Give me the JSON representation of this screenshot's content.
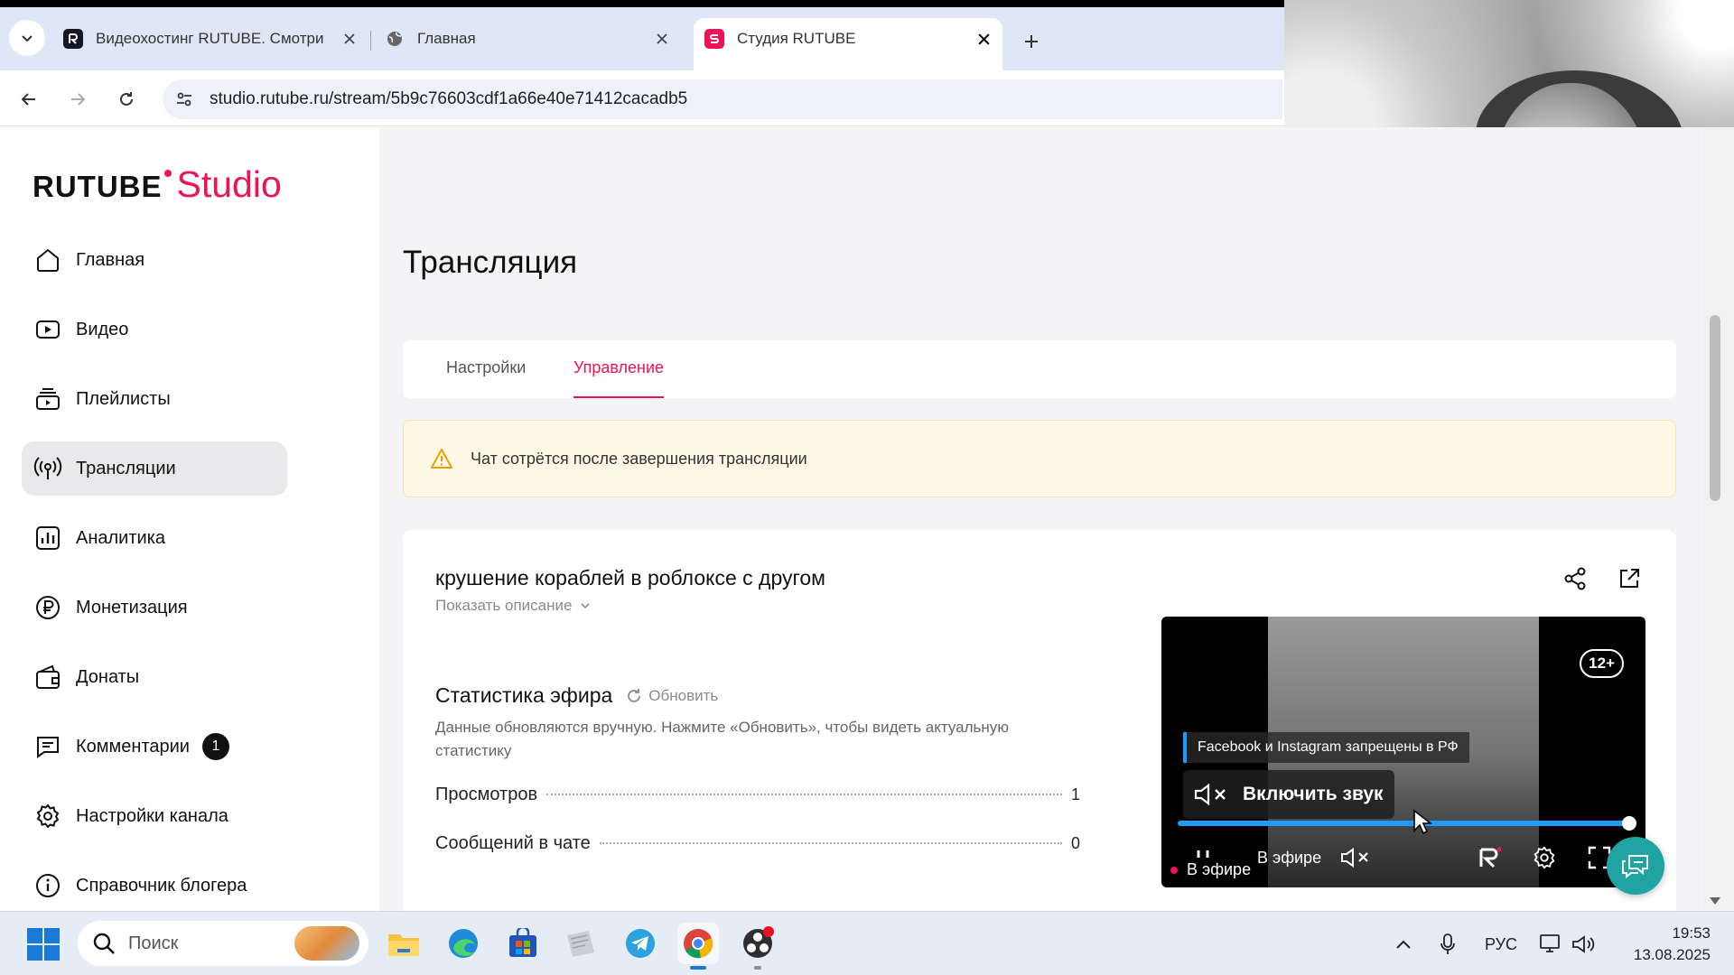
{
  "browser": {
    "tabs": [
      {
        "title": "Видеохостинг RUTUBE. Смотри",
        "icon": "rutube-favicon",
        "active": false
      },
      {
        "title": "Главная",
        "icon": "globe-favicon",
        "active": false
      },
      {
        "title": "Студия RUTUBE",
        "icon": "rutube-studio-favicon",
        "active": true
      }
    ],
    "url": "studio.rutube.ru/stream/5b9c76603cdf1a66e40e71412cacadb5"
  },
  "colors": {
    "accent": "#ed1456",
    "player_progress": "#1e9bff",
    "chat_fab": "#1fa3a3",
    "alert_bg": "#fdf8e6"
  },
  "logo": {
    "main": "RUTUBE",
    "sub": "Studio"
  },
  "sidebar": {
    "items": [
      {
        "label": "Главная",
        "icon": "home-icon"
      },
      {
        "label": "Видео",
        "icon": "video-icon"
      },
      {
        "label": "Плейлисты",
        "icon": "playlist-icon"
      },
      {
        "label": "Трансляции",
        "icon": "broadcast-icon",
        "active": true
      },
      {
        "label": "Аналитика",
        "icon": "analytics-icon"
      },
      {
        "label": "Монетизация",
        "icon": "ruble-icon"
      },
      {
        "label": "Донаты",
        "icon": "wallet-icon"
      },
      {
        "label": "Комментарии",
        "icon": "comment-icon",
        "badge": "1"
      },
      {
        "label": "Настройки канала",
        "icon": "gear-icon"
      },
      {
        "label": "Справочник блогера",
        "icon": "info-icon"
      }
    ]
  },
  "main": {
    "title": "Трансляция",
    "tabs": [
      {
        "label": "Настройки",
        "active": false
      },
      {
        "label": "Управление",
        "active": true
      }
    ],
    "alert": "Чат сотрётся после завершения трансляции",
    "stream": {
      "title": "крушение кораблей в роблоксе с другом",
      "show_description": "Показать описание"
    },
    "stats": {
      "title": "Статистика эфира",
      "refresh": "Обновить",
      "hint": "Данные обновляются вручную. Нажмите «Обновить», чтобы видеть актуальную статистику",
      "rows": [
        {
          "label": "Просмотров",
          "value": "1"
        },
        {
          "label": "Сообщений в чате",
          "value": "0"
        }
      ]
    },
    "player": {
      "age": "12+",
      "notice": "Facebook и Instagram запрещены в РФ",
      "unmute": "Включить звук",
      "live_control": "В эфире",
      "live_label": "В эфире",
      "progress": 1.0
    }
  },
  "taskbar": {
    "search_placeholder": "Поиск",
    "apps": [
      "file-explorer-icon",
      "edge-icon",
      "store-icon",
      "notes-icon",
      "telegram-icon",
      "chrome-icon",
      "obs-icon"
    ],
    "lang": "РУС",
    "time": "19:53",
    "date": "13.08.2025"
  }
}
